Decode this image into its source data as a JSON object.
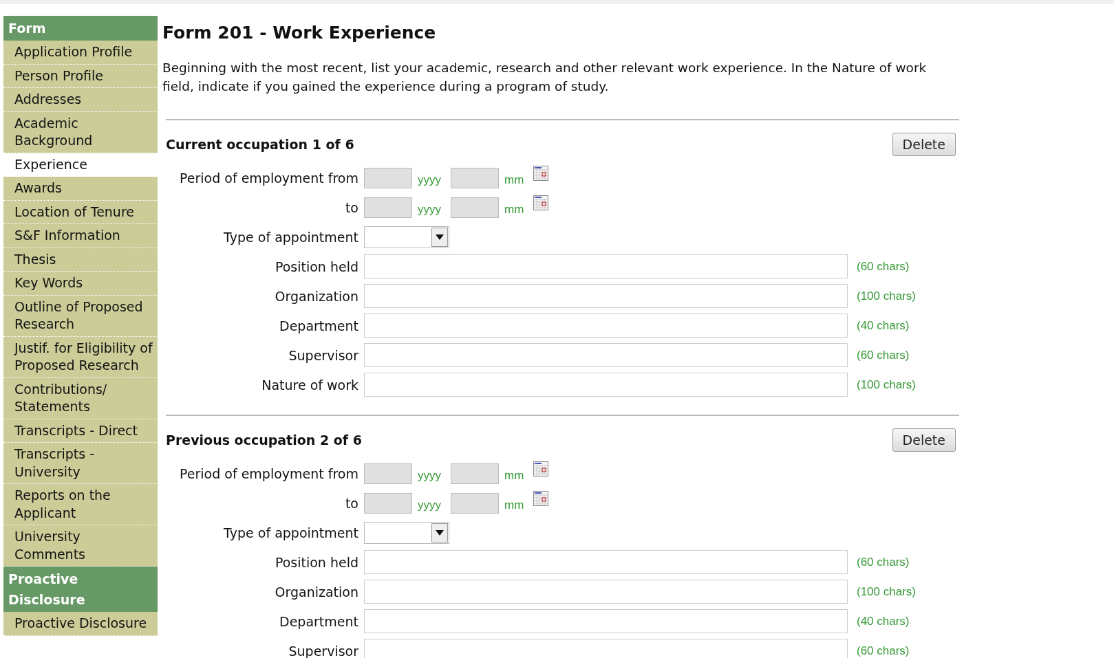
{
  "sidebar": {
    "sections": [
      {
        "title": "Form",
        "items": [
          {
            "label": "Application Profile",
            "selected": false
          },
          {
            "label": "Person Profile",
            "selected": false
          },
          {
            "label": "Addresses",
            "selected": false
          },
          {
            "label": "Academic Background",
            "selected": false
          },
          {
            "label": "Experience",
            "selected": true
          },
          {
            "label": "Awards",
            "selected": false
          },
          {
            "label": "Location of Tenure",
            "selected": false
          },
          {
            "label": "S&F Information",
            "selected": false
          },
          {
            "label": "Thesis",
            "selected": false
          },
          {
            "label": "Key Words",
            "selected": false
          },
          {
            "label": "Outline of Proposed Research",
            "selected": false
          },
          {
            "label": "Justif. for Eligibility of Proposed Research",
            "selected": false
          },
          {
            "label": "Contributions/ Statements",
            "selected": false
          },
          {
            "label": "Transcripts - Direct",
            "selected": false
          },
          {
            "label": "Transcripts - University",
            "selected": false
          },
          {
            "label": "Reports on the Applicant",
            "selected": false
          },
          {
            "label": "University Comments",
            "selected": false
          }
        ]
      },
      {
        "title": "Proactive Disclosure",
        "items": [
          {
            "label": "Proactive Disclosure",
            "selected": false
          }
        ]
      }
    ]
  },
  "page": {
    "title": "Form 201 - Work Experience",
    "intro": "Beginning with the most recent, list your academic, research and other relevant work experience. In the Nature of work field, indicate if you gained the experience during a program of study."
  },
  "occupations": [
    {
      "heading": "Current occupation 1 of 6",
      "delete_button": "Delete",
      "fields": [
        {
          "kind": "date",
          "label": "Period of employment from",
          "year_hint": "yyyy",
          "month_hint": "mm"
        },
        {
          "kind": "date",
          "label": "to",
          "year_hint": "yyyy",
          "month_hint": "mm"
        },
        {
          "kind": "select",
          "label": "Type of appointment"
        },
        {
          "kind": "text",
          "label": "Position held",
          "limit": "(60 chars)"
        },
        {
          "kind": "text",
          "label": "Organization",
          "limit": "(100 chars)"
        },
        {
          "kind": "text",
          "label": "Department",
          "limit": "(40 chars)"
        },
        {
          "kind": "text",
          "label": "Supervisor",
          "limit": "(60 chars)"
        },
        {
          "kind": "text",
          "label": "Nature of work",
          "limit": "(100 chars)"
        }
      ]
    },
    {
      "heading": "Previous occupation 2 of 6",
      "delete_button": "Delete",
      "fields": [
        {
          "kind": "date",
          "label": "Period of employment from",
          "year_hint": "yyyy",
          "month_hint": "mm"
        },
        {
          "kind": "date",
          "label": "to",
          "year_hint": "yyyy",
          "month_hint": "mm"
        },
        {
          "kind": "select",
          "label": "Type of appointment"
        },
        {
          "kind": "text",
          "label": "Position held",
          "limit": "(60 chars)"
        },
        {
          "kind": "text",
          "label": "Organization",
          "limit": "(100 chars)"
        },
        {
          "kind": "text",
          "label": "Department",
          "limit": "(40 chars)"
        },
        {
          "kind": "text",
          "label": "Supervisor",
          "limit": "(60 chars)"
        }
      ]
    }
  ]
}
